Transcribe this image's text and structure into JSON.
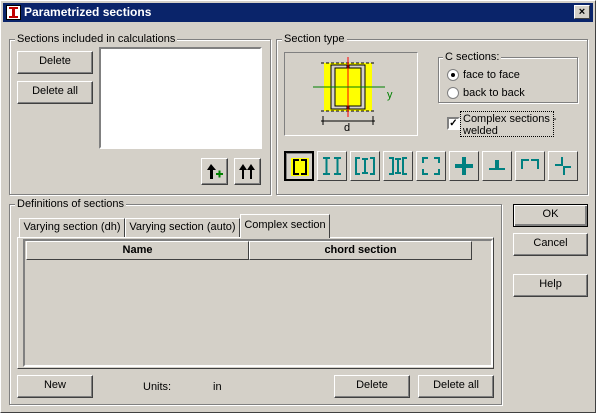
{
  "window": {
    "title": "Parametrized sections",
    "close_glyph": "×"
  },
  "sections_included": {
    "legend": "Sections included in calculations",
    "delete_label": "Delete",
    "delete_all_label": "Delete all",
    "items": []
  },
  "section_type": {
    "legend": "Section type",
    "preview": {
      "axis_label": "y",
      "dim_label": "d"
    },
    "c_sections": {
      "legend": "C sections:",
      "options": [
        {
          "label": "face to face",
          "selected": true
        },
        {
          "label": "back to back",
          "selected": false
        }
      ]
    },
    "complex_welded": {
      "line1": "Complex sections -",
      "line2": "welded",
      "checked": true,
      "mark": "✓"
    },
    "buttons": [
      "c-face-to-face-icon",
      "double-i-icon",
      "i-in-channels-icon",
      "channel-i-channel-icon",
      "c-open-pair-icon",
      "cross-angles-icon",
      "tee-angles-icon",
      "angle-pair-icon",
      "offset-angles-icon"
    ]
  },
  "definitions": {
    "legend": "Definitions of sections",
    "tabs": [
      "Varying section (dh)",
      "Varying section (auto)",
      "Complex section"
    ],
    "active_tab": 2,
    "columns": [
      "Name",
      "chord section"
    ],
    "rows": [],
    "new_label": "New",
    "units_label": "Units:",
    "units_value": "in",
    "delete_label": "Delete",
    "delete_all_label": "Delete all"
  },
  "dialog_buttons": {
    "ok": "OK",
    "cancel": "Cancel",
    "help": "Help"
  },
  "colors": {
    "title_bar": "#0a246a",
    "section_fill": "#ffff00",
    "accent_green": "#008000",
    "accent_teal": "#008080",
    "accent_red": "#ff0000"
  }
}
